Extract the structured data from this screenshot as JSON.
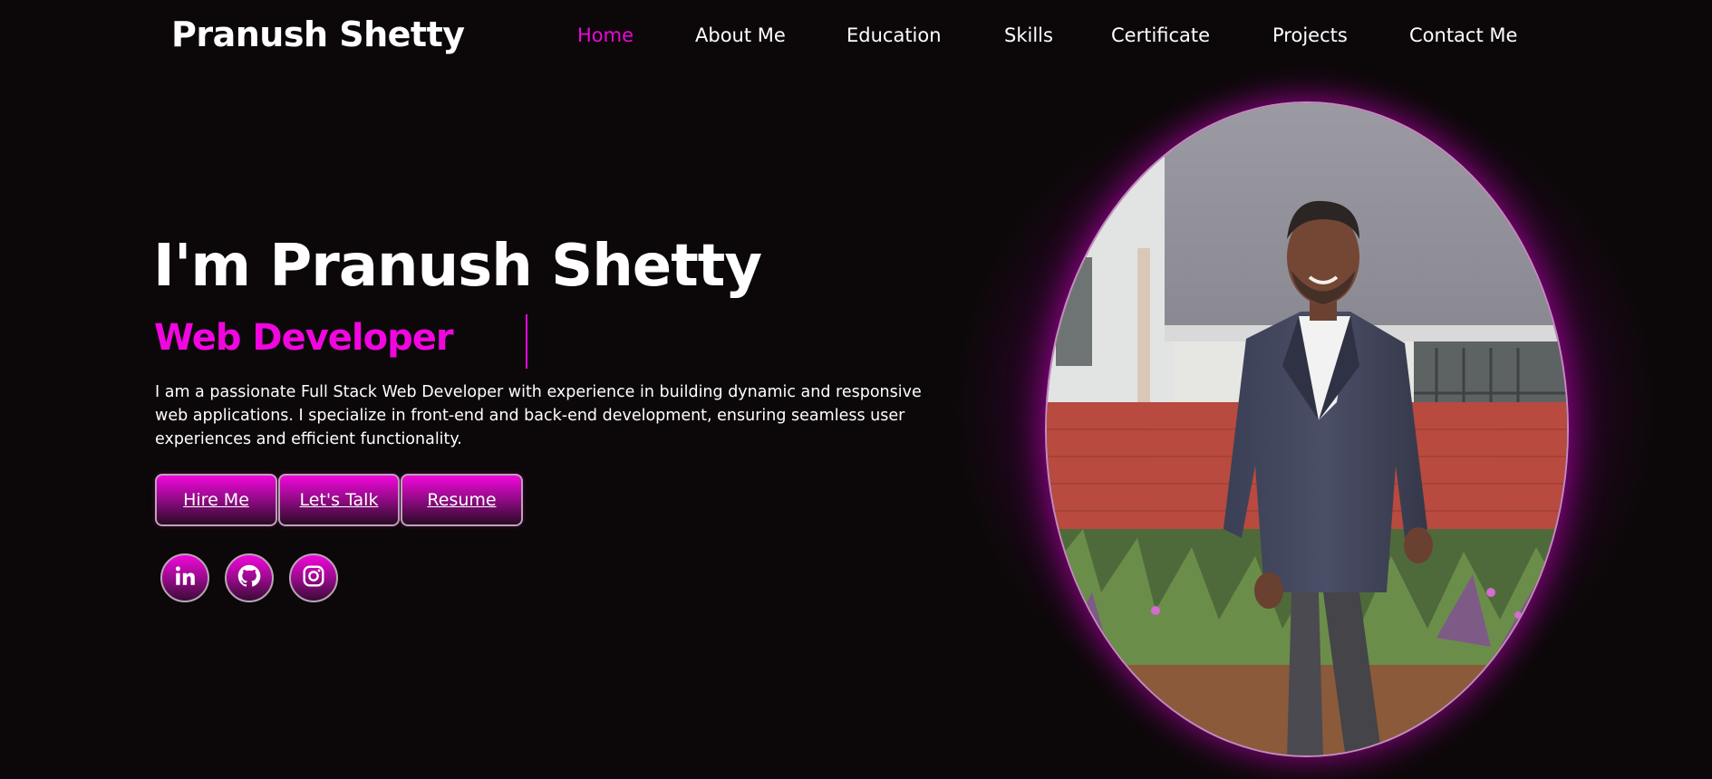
{
  "brand": {
    "name": "Pranush Shetty"
  },
  "nav": {
    "items": [
      {
        "label": "Home",
        "active": true
      },
      {
        "label": "About Me"
      },
      {
        "label": "Education"
      },
      {
        "label": "Skills"
      },
      {
        "label": "Certificate"
      },
      {
        "label": "Projects"
      },
      {
        "label": "Contact Me"
      }
    ]
  },
  "hero": {
    "title": "I'm Pranush Shetty",
    "role": "Web Developer",
    "description": "I am a passionate Full Stack Web Developer with experience in building dynamic and responsive web applications. I specialize in front-end and back-end development, ensuring seamless user experiences and efficient functionality.",
    "buttons": {
      "hire": "Hire Me",
      "talk": "Let's Talk",
      "resume": "Resume"
    }
  },
  "social": {
    "linkedin": "linkedin-icon",
    "github": "github-icon",
    "instagram": "instagram-icon"
  },
  "colors": {
    "accent": "#f006de",
    "background": "#0c0809",
    "text": "#ffffff"
  },
  "photo": {
    "subject": "portrait"
  }
}
